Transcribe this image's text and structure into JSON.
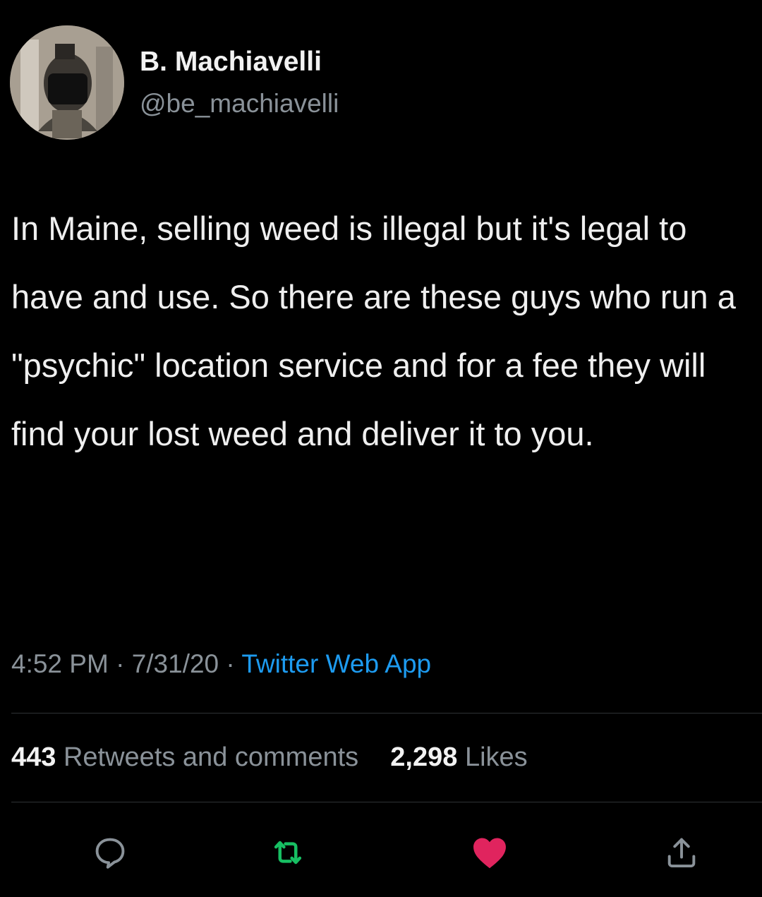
{
  "author": {
    "display_name": "B. Machiavelli",
    "handle": "@be_machiavelli",
    "avatar_icon": "profile-photo"
  },
  "tweet": {
    "text": "In Maine, selling weed is illegal but it's legal to have and use. So there are these guys who run a \"psychic\" location service and for a fee they will find your lost weed and deliver it to you.",
    "time": "4:52 PM",
    "date": "7/31/20",
    "separator": "·",
    "source": "Twitter Web App"
  },
  "stats": {
    "retweets_count": "443",
    "retweets_label": "Retweets and comments",
    "likes_count": "2,298",
    "likes_label": "Likes"
  },
  "actions": {
    "reply_icon": "reply-icon",
    "retweet_icon": "retweet-icon",
    "like_icon": "heart-icon",
    "share_icon": "share-icon"
  },
  "colors": {
    "background": "#000000",
    "link": "#1d9bf0",
    "retweet": "#17bf63",
    "like": "#e0245e",
    "secondary_text": "#8a9299"
  }
}
